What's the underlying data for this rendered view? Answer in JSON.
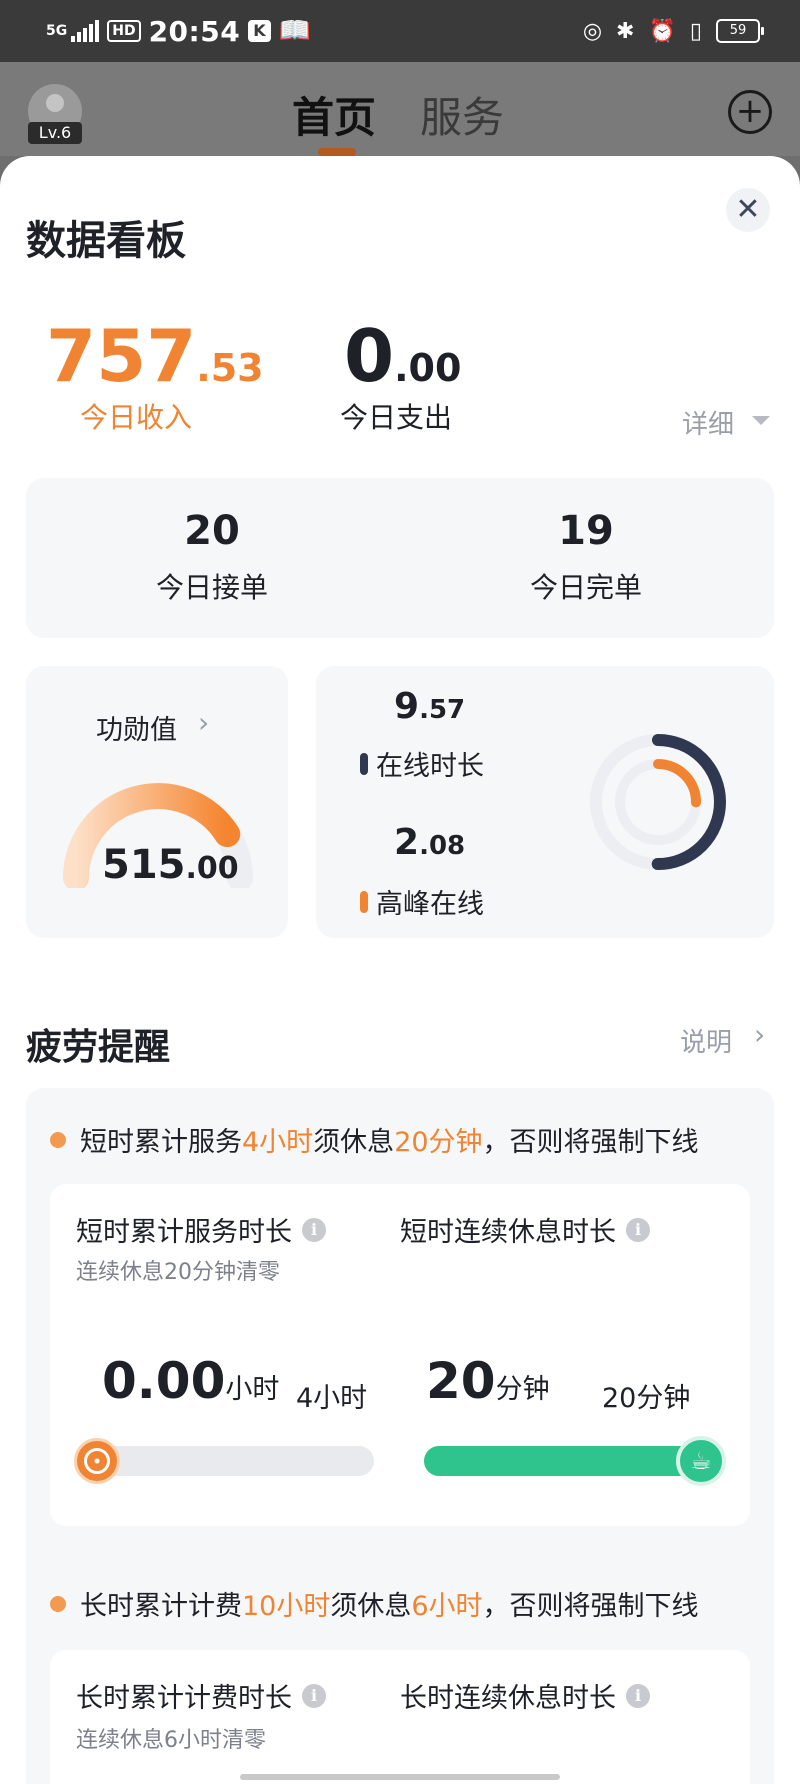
{
  "status_bar": {
    "network": "5G",
    "hd": "HD",
    "time": "20:54",
    "app_badge": "K",
    "battery": "59"
  },
  "header": {
    "level": "Lv.6",
    "tabs": [
      {
        "label": "首页"
      },
      {
        "label": "服务"
      }
    ]
  },
  "dashboard": {
    "title": "数据看板",
    "income": {
      "int": "757",
      "dec": ".53",
      "label": "今日收入"
    },
    "expense": {
      "int": "0",
      "dec": ".00",
      "label": "今日支出"
    },
    "detail_label": "详细",
    "orders": [
      {
        "value": "20",
        "label": "今日接单"
      },
      {
        "value": "19",
        "label": "今日完单"
      }
    ],
    "merit": {
      "label": "功勋值",
      "int": "515",
      "dec": ".00",
      "progress": 0.82
    },
    "online": {
      "int": "9",
      "dec": ".57",
      "label": "在线时长"
    },
    "peak": {
      "int": "2",
      "dec": ".08",
      "label": "高峰在线"
    },
    "colors": {
      "accent": "#f08432",
      "dark": "#2f3850",
      "green": "#2fc38d"
    }
  },
  "fatigue": {
    "title": "疲劳提醒",
    "explain_label": "说明",
    "short": {
      "rule": {
        "a": "短时累计服务",
        "b": "4小时",
        "c": "须休息",
        "d": "20分钟",
        "e": "，否则将强制下线"
      },
      "service_title": "短时累计服务时长",
      "service_sub": "连续休息20分钟清零",
      "service_value": "0.00",
      "service_unit": "小时",
      "service_limit": "4小时",
      "service_progress": 0.0,
      "rest_title": "短时连续休息时长",
      "rest_value": "20",
      "rest_unit": "分钟",
      "rest_limit": "20分钟",
      "rest_progress": 1.0
    },
    "long": {
      "rule": {
        "a": "长时累计计费",
        "b": "10小时",
        "c": "须休息",
        "d": "6小时",
        "e": "，否则将强制下线"
      },
      "service_title": "长时累计计费时长",
      "service_sub": "连续休息6小时清零",
      "rest_title": "长时连续休息时长"
    }
  }
}
